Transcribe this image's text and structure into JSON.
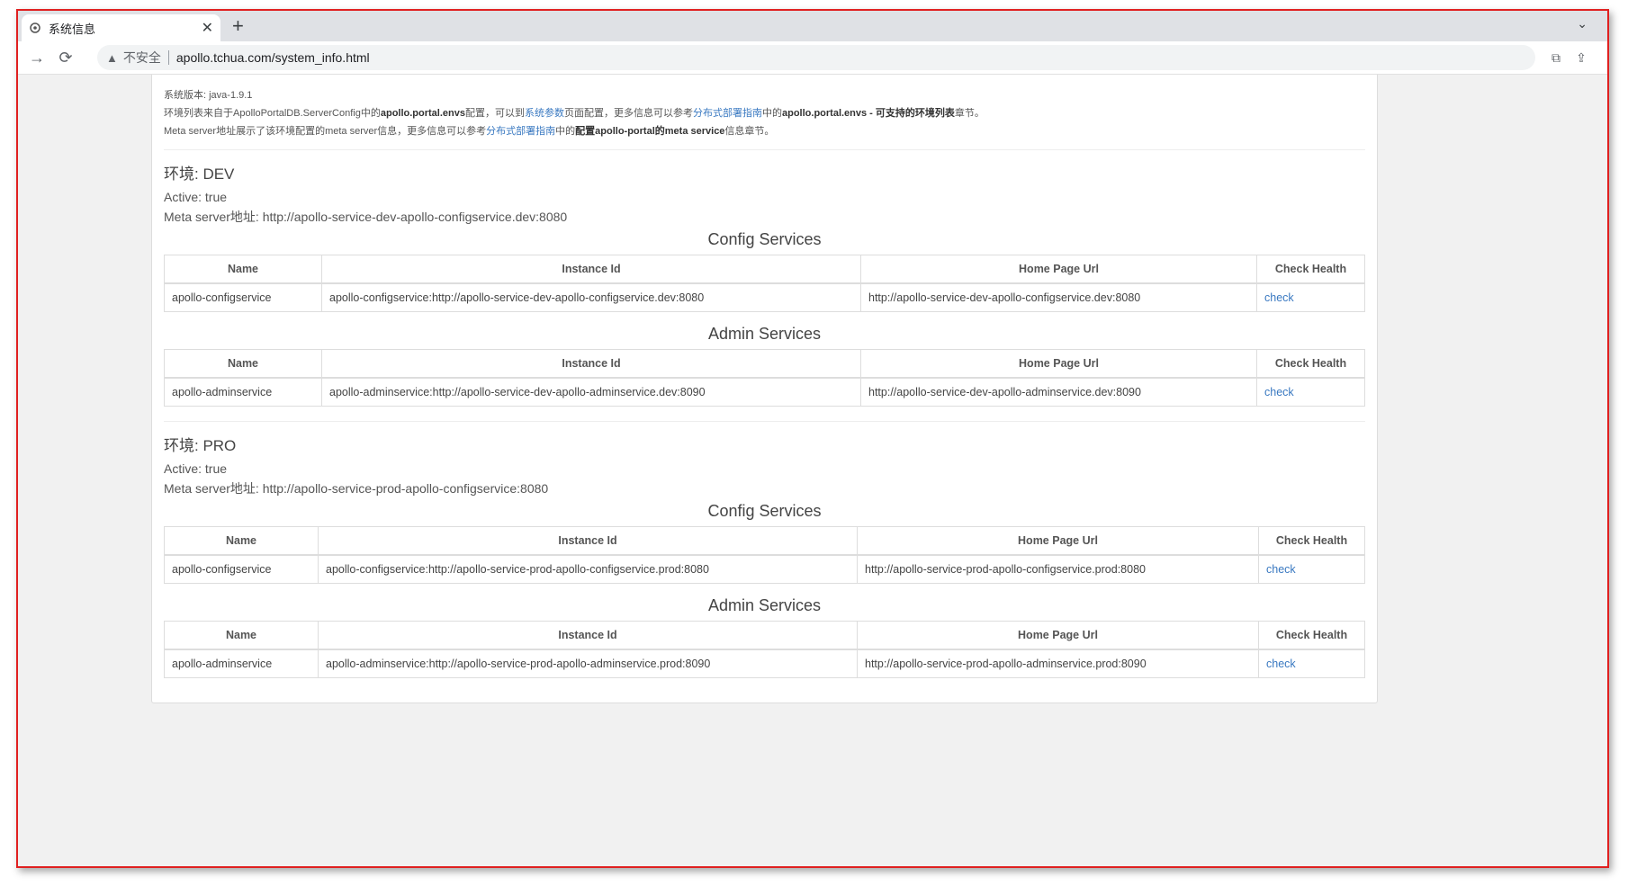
{
  "browser": {
    "tab_title": "系统信息",
    "new_tab": "+",
    "insecure_label": "不安全",
    "url": "apollo.tchua.com/system_info.html"
  },
  "page": {
    "version_line": "系统版本: java-1.9.1",
    "env_note": {
      "p1": "环境列表来自于ApolloPortalDB.ServerConfig中的",
      "b1": "apollo.portal.envs",
      "p2": "配置，可以到",
      "link1": "系统参数",
      "p3": "页面配置，更多信息可以参考",
      "link2": "分布式部署指南",
      "p4": "中的",
      "b2": "apollo.portal.envs - 可支持的环境列表",
      "p5": "章节。"
    },
    "meta_note": {
      "p1": "Meta server地址展示了该环境配置的meta server信息，更多信息可以参考",
      "link1": "分布式部署指南",
      "p2": "中的",
      "b1": "配置apollo-portal的meta service",
      "p3": "信息章节。"
    },
    "table_headers": {
      "name": "Name",
      "instance_id": "Instance Id",
      "home_page_url": "Home Page Url",
      "check_health": "Check Health"
    },
    "envs": [
      {
        "title": "环境: DEV",
        "active": "Active: true",
        "meta": "Meta server地址: http://apollo-service-dev-apollo-configservice.dev:8080",
        "config_caption": "Config Services",
        "config_row": {
          "name": "apollo-configservice",
          "instance_id": "apollo-configservice:http://apollo-service-dev-apollo-configservice.dev:8080",
          "url": "http://apollo-service-dev-apollo-configservice.dev:8080",
          "check": "check"
        },
        "admin_caption": "Admin Services",
        "admin_row": {
          "name": "apollo-adminservice",
          "instance_id": "apollo-adminservice:http://apollo-service-dev-apollo-adminservice.dev:8090",
          "url": "http://apollo-service-dev-apollo-adminservice.dev:8090",
          "check": "check"
        }
      },
      {
        "title": "环境: PRO",
        "active": "Active: true",
        "meta": "Meta server地址: http://apollo-service-prod-apollo-configservice:8080",
        "config_caption": "Config Services",
        "config_row": {
          "name": "apollo-configservice",
          "instance_id": "apollo-configservice:http://apollo-service-prod-apollo-configservice.prod:8080",
          "url": "http://apollo-service-prod-apollo-configservice.prod:8080",
          "check": "check"
        },
        "admin_caption": "Admin Services",
        "admin_row": {
          "name": "apollo-adminservice",
          "instance_id": "apollo-adminservice:http://apollo-service-prod-apollo-adminservice.prod:8090",
          "url": "http://apollo-service-prod-apollo-adminservice.prod:8090",
          "check": "check"
        }
      }
    ]
  },
  "colors": {
    "link": "#3a79c1",
    "frame_border": "#e02020"
  }
}
